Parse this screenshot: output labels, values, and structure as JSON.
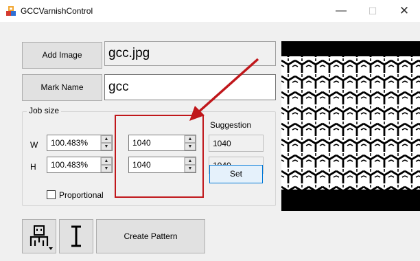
{
  "window": {
    "title": "GCCVarnishControl",
    "controls": {
      "minimize": "—",
      "maximize": "☐",
      "close": "✕"
    }
  },
  "add_image": {
    "label": "Add Image",
    "value": "gcc.jpg"
  },
  "mark_name": {
    "label": "Mark Name",
    "value": "gcc"
  },
  "job_size": {
    "label": "Job size",
    "w_label": "W",
    "h_label": "H",
    "w_percent": "100.483%",
    "h_percent": "100.483%",
    "w_value": "1040",
    "h_value": "1040",
    "suggestion_label": "Suggestion",
    "suggestion_w": "1040",
    "suggestion_h": "1040",
    "set_label": "Set",
    "proportional_label": "Proportional",
    "proportional_checked": false
  },
  "toolbar": {
    "create_pattern_label": "Create Pattern"
  },
  "colors": {
    "annotation_red": "#c0171b",
    "accent_blue": "#0078d7"
  }
}
